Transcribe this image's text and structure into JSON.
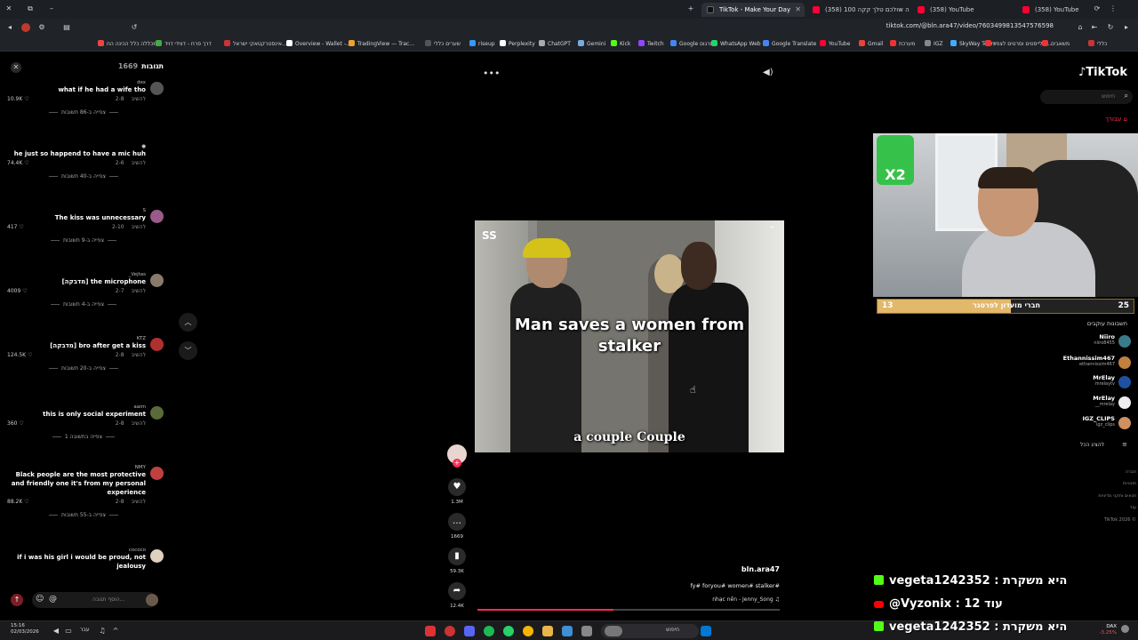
{
  "browser": {
    "tabs": [
      {
        "label": "TikTok - Make Your Day",
        "active": true,
        "color": "#ffffff"
      },
      {
        "label": "(358) ולכם טלך קקה 100w הוה",
        "active": false,
        "color": "#ff0033"
      },
      {
        "label": "(358) YouTube",
        "active": false,
        "color": "#ff0033"
      },
      {
        "label": "(358) YouTube",
        "active": false,
        "color": "#ff0033"
      }
    ],
    "url": "tiktok.com/@bln.ara47/video/7603499813547576598",
    "bookmarks": [
      "מכללה כלל הכינה הח...",
      "דרך פרח - דווידי דויד",
      "אינסטרקטאקי ישראל...",
      "Overview - Wallet -...",
      "TradingView — Trac...",
      "שערים כללי",
      "riseup",
      "Perplexity",
      "ChatGPT",
      "Gemini",
      "Kick",
      "Twitch",
      "Google תרגום",
      "WhatsApp Web",
      "Google Translate",
      "YouTube",
      "Gmail",
      "מערכת",
      "IGZ",
      "SkyWay Tours",
      "פלייסטים וסרטים לצפיי...",
      "משאבים",
      "כללי"
    ]
  },
  "comments": {
    "title": "תגובות",
    "count": "1669",
    "input_placeholder": "הוסף תגובה...",
    "items": [
      {
        "user": "dex",
        "text": "what if he had a wife tho",
        "date": "2-8",
        "reply": "להשיב",
        "likes": "10.9K",
        "more": "צפייה ב-86 תשובות",
        "avatar": "#555555"
      },
      {
        "user": "●",
        "text": "he just so happend to have a mic huh",
        "date": "2-6",
        "reply": "להשיב",
        "likes": "74.4K",
        "more": "צפייה ב-40 תשובות",
        "avatar": ""
      },
      {
        "user": "S",
        "text": "The kiss was unnecessary",
        "date": "2-10",
        "reply": "להשיב",
        "likes": "417",
        "more": "צפייה ב-9 תשובות",
        "avatar": "#9a5a8a"
      },
      {
        "user": "_Vejtas",
        "text": "[מדבקה] the microphone",
        "date": "2-7",
        "reply": "להשיב",
        "likes": "4009",
        "more": "צפייה ב-4 תשובות",
        "avatar": "#8a7a6a"
      },
      {
        "user": "KTZ",
        "text": "[מדבקה] bro after get a kiss",
        "date": "2-8",
        "reply": "להשיב",
        "likes": "124.5K",
        "more": "צפייה ב-20 תשובות",
        "avatar": "#b03030"
      },
      {
        "user": "aaim",
        "text": "this is only social experiment",
        "date": "2-8",
        "reply": "להשיב",
        "likes": "360",
        "more": "צפייה בתשובה 1",
        "avatar": "#5a6a3a"
      },
      {
        "user": "NMY",
        "text": "Black people are the most protective and friendly one it's from my personal experience",
        "date": "2-8",
        "reply": "להשיב",
        "likes": "88.2K",
        "more": "צפייה ב-55 תשובות",
        "avatar": "#c04040"
      },
      {
        "user": "cococo",
        "text": "if i was his girl i would be proud, not jealousy",
        "date": "",
        "reply": "",
        "likes": "",
        "more": "",
        "avatar": "#e0d0c0"
      }
    ]
  },
  "video": {
    "title_caption": "Man saves a women from stalker",
    "bottom_caption": "a couple Couple",
    "author": "bln.ara47",
    "hashtags": "fy# foryou# women# stalker#",
    "sound": "nhạc nền - Jenny_Song ♫",
    "progress_fraction": 0.45
  },
  "actions": {
    "likes": "1.3M",
    "comments": "1669",
    "saves": "59.3K",
    "shares": "12.4K"
  },
  "right_panel": {
    "brand": "TikTok",
    "search_placeholder": "חיפוש",
    "foryou": "עבורך",
    "stream_banner": "חברי מועדון לפרטנר",
    "stream_left_num": "13",
    "stream_right_num": "25",
    "following_title": "חשבונות עוקבים",
    "accounts": [
      {
        "name": "Niiro",
        "handle": "niiro8455",
        "color": "#3a7a8a"
      },
      {
        "name": "Ethannissim467",
        "handle": "ethannissim467",
        "color": "#c08040"
      },
      {
        "name": "MrElay",
        "handle": "mrelaytv",
        "color": "#2050a0"
      },
      {
        "name": "MrElay",
        "handle": "__mrelay",
        "color": "#eeeeee"
      },
      {
        "name": "IGZ_CLIPS",
        "handle": "igz_clips",
        "color": "#d09060"
      }
    ],
    "show_all": "להציג הכל",
    "footer": [
      "חברה",
      "תוכניות",
      "תנאים ותקני מדיניות",
      "עוד",
      "TikTok 2026 ©"
    ]
  },
  "chat_overlay": [
    {
      "icon": "kick",
      "text": "vegeta1242352 : היא משקרת",
      "color": "#53fc18"
    },
    {
      "icon": "youtube",
      "text": "@Vyzonix : עוד 12",
      "color": "#ff0000"
    },
    {
      "icon": "kick",
      "text": "vegeta1242352 : היא משקרת",
      "color": "#53fc18"
    }
  ],
  "taskbar": {
    "time": "15:16",
    "date": "02/03/2026",
    "lang": "עבר",
    "search_label": "חיפוש",
    "ticker_name": "DAX",
    "ticker_change": "-3.25%"
  }
}
